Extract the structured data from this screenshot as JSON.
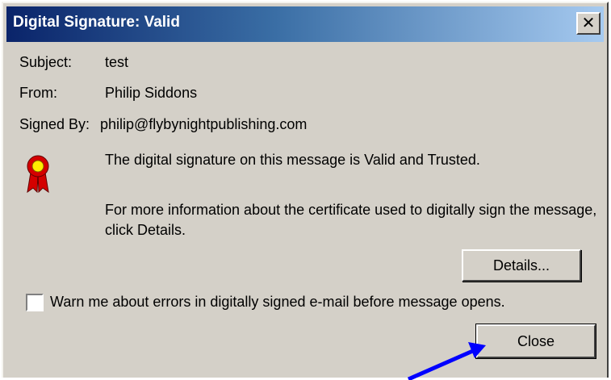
{
  "window": {
    "title": "Digital Signature: Valid",
    "close_glyph": "✕"
  },
  "fields": {
    "subject_label": "Subject:",
    "subject_value": "test",
    "from_label": "From:",
    "from_value": "Philip Siddons",
    "signed_by_label": "Signed By:",
    "signed_by_value": "philip@flybynightpublishing.com"
  },
  "message": {
    "status": "The digital signature on this message is Valid and Trusted.",
    "info": "For more information about the certificate used to digitally sign the message, click Details."
  },
  "buttons": {
    "details_label": "Details...",
    "close_label": "Close"
  },
  "warn_checkbox": {
    "label": "Warn me about errors in digitally signed e-mail before message opens.",
    "checked": false
  },
  "icons": {
    "seal": "ribbon-seal-icon",
    "annotation": "blue-arrow-pointer"
  },
  "colors": {
    "title_gradient_start": "#0a246a",
    "title_gradient_end": "#a6caf0",
    "dialog_bg": "#d4d0c8",
    "arrow": "#0000ff",
    "seal_red": "#d40000",
    "seal_yellow": "#ffee00"
  }
}
